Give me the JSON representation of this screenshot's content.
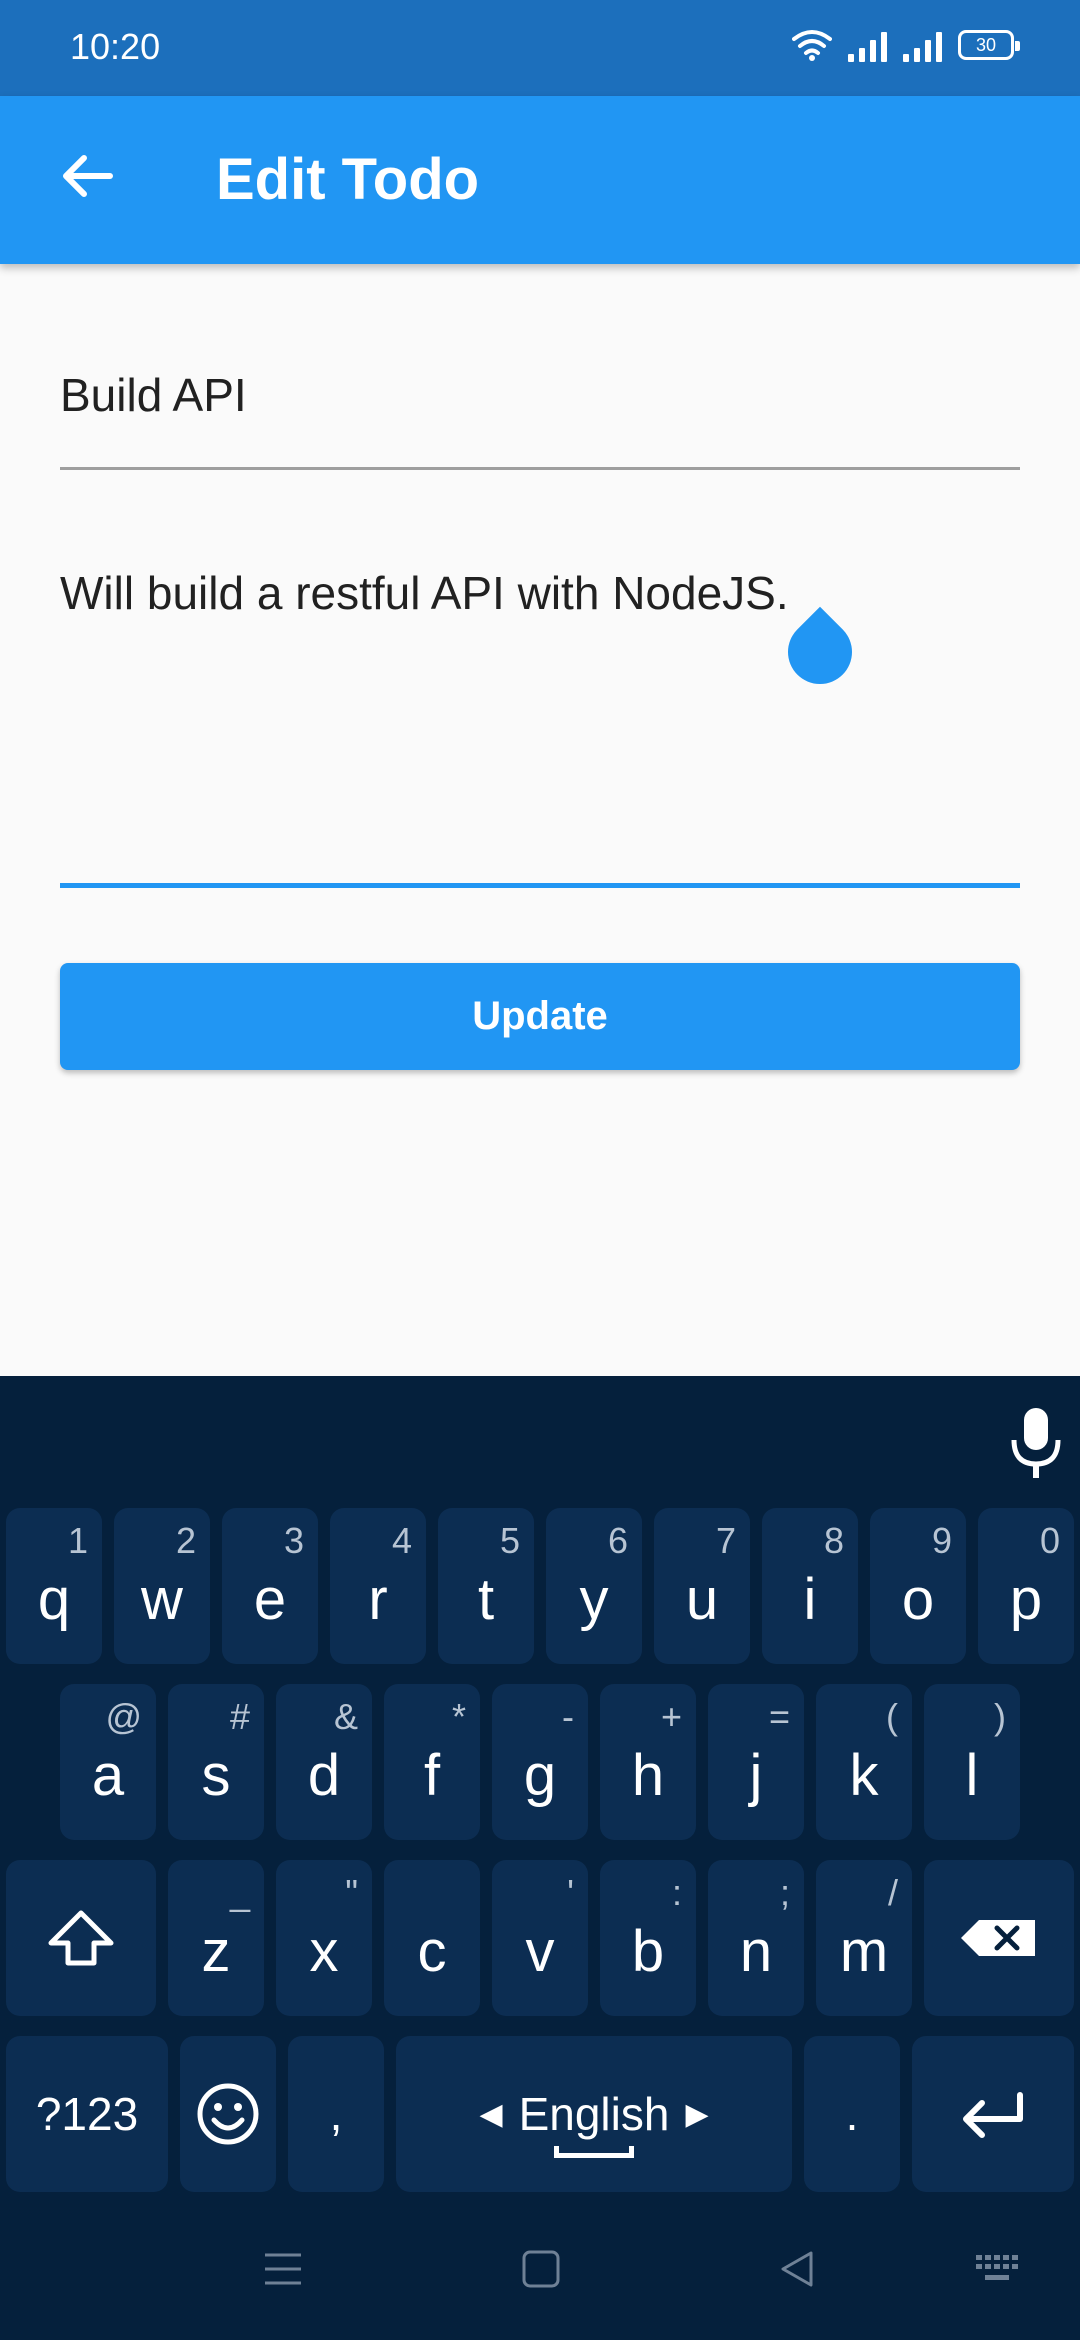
{
  "status_bar": {
    "time": "10:20",
    "battery": "30"
  },
  "app_bar": {
    "title": "Edit Todo"
  },
  "form": {
    "title_value": "Build API",
    "description_value": "Will build a restful API with NodeJS.",
    "update_label": "Update"
  },
  "keyboard": {
    "row1": [
      {
        "key": "q",
        "alt": "1"
      },
      {
        "key": "w",
        "alt": "2"
      },
      {
        "key": "e",
        "alt": "3"
      },
      {
        "key": "r",
        "alt": "4"
      },
      {
        "key": "t",
        "alt": "5"
      },
      {
        "key": "y",
        "alt": "6"
      },
      {
        "key": "u",
        "alt": "7"
      },
      {
        "key": "i",
        "alt": "8"
      },
      {
        "key": "o",
        "alt": "9"
      },
      {
        "key": "p",
        "alt": "0"
      }
    ],
    "row2": [
      {
        "key": "a",
        "alt": "@"
      },
      {
        "key": "s",
        "alt": "#"
      },
      {
        "key": "d",
        "alt": "&"
      },
      {
        "key": "f",
        "alt": "*"
      },
      {
        "key": "g",
        "alt": "-"
      },
      {
        "key": "h",
        "alt": "+"
      },
      {
        "key": "j",
        "alt": "="
      },
      {
        "key": "k",
        "alt": "("
      },
      {
        "key": "l",
        "alt": ")"
      }
    ],
    "row3": [
      {
        "key": "z",
        "alt": "_"
      },
      {
        "key": "x",
        "alt": "\""
      },
      {
        "key": "c",
        "alt": ""
      },
      {
        "key": "v",
        "alt": "'"
      },
      {
        "key": "b",
        "alt": ":"
      },
      {
        "key": "n",
        "alt": ";"
      },
      {
        "key": "m",
        "alt": "/"
      }
    ],
    "symbols_label": "?123",
    "comma_label": ",",
    "space_label": "English",
    "period_label": "."
  }
}
